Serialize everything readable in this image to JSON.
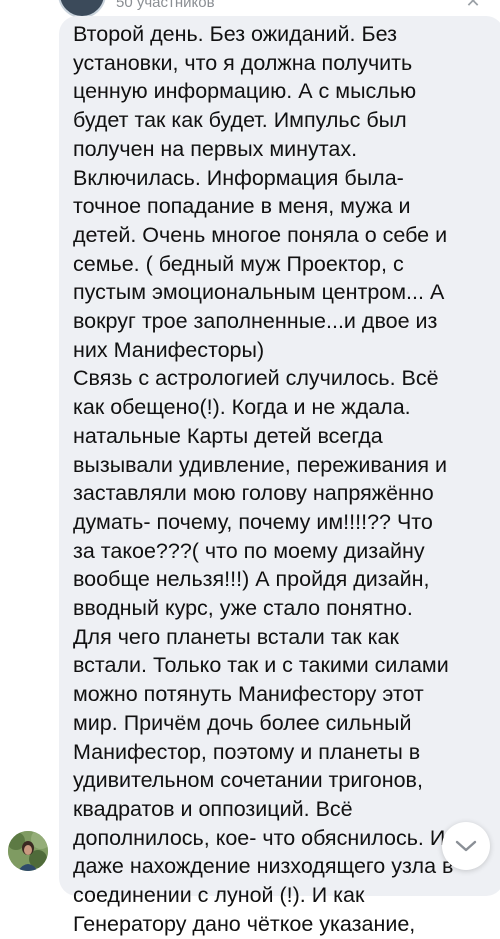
{
  "chat": {
    "subtitle": "50 участников"
  },
  "message": {
    "lines": [
      "Второй день. Без ожиданий. Без",
      "установки, что я должна получить",
      "ценную информацию. А с мыслью",
      "будет так как будет. Импульс был",
      "получен на первых минутах.",
      "Включилась. Информация была-",
      "точное попадание в меня, мужа и",
      "детей. Очень многое поняла о себе и",
      "семье. ( бедный муж Проектор, с",
      "пустым эмоциональным центром... А",
      "вокруг трое заполненные...и двое из",
      "них Манифесторы)",
      "Связь с астрологией случилось. Всё",
      "как обещено(!). Когда и не ждала.",
      "натальные Карты детей всегда",
      "вызывали удивление, переживания и",
      "заставляли мою голову напряжённо",
      "думать- почему, почему им!!!!?? Что",
      "за такое???( что по моему дизайну",
      "вообще нельзя!!!) А пройдя дизайн,",
      "вводный курс, уже стало понятно.",
      "Для чего планеты встали так как",
      "встали. Только так и с такими силами",
      "можно потянуть Манифестору этот",
      "мир. Причём дочь более сильный",
      "Манифестор, поэтому и планеты в",
      "удивительном сочетании тригонов,",
      "квадратов и оппозиций.  Всё",
      "дополнилось, кое- что обяснилось. И",
      "даже нахождение низходящего узла в",
      "соединении с луной (!).  И как",
      "Генератору дано чёткое указание,"
    ]
  },
  "icons": {
    "close": "close-icon",
    "scroll_down": "chevron-down-icon",
    "sender_avatar": "avatar"
  },
  "colors": {
    "bubble": "#eef0f4",
    "text": "#111111",
    "subtitle": "#8a8e93"
  }
}
